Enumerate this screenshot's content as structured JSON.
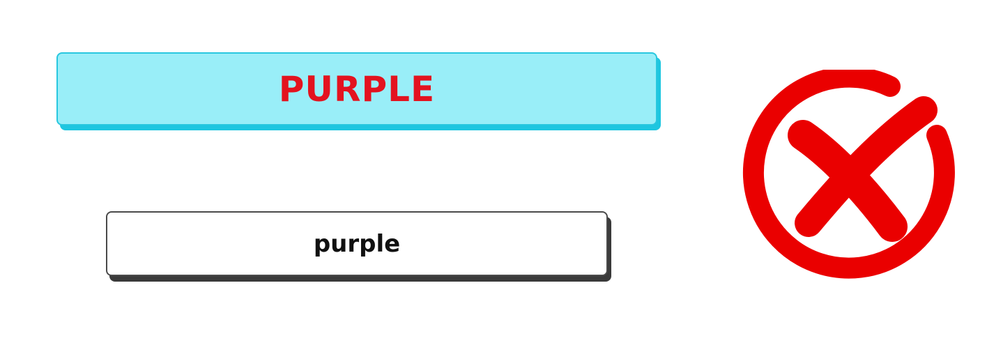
{
  "prompt": {
    "word": "PURPLE",
    "text_color": "#e3131f",
    "background_color": "#99eef8"
  },
  "answer_option": {
    "label": "purple"
  },
  "result": {
    "icon": "wrong-cross-circle-icon",
    "color": "#ea0000"
  }
}
